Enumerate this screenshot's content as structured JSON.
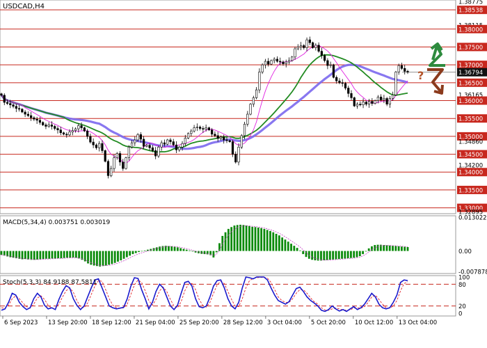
{
  "chart_data": [
    {
      "type": "candlestick",
      "title": "USDCAD,H4",
      "price_labels": [
        "1.38775",
        "1.38538",
        "1.38115",
        "1.38000",
        "1.37500",
        "1.37000",
        "1.36794",
        "1.36500",
        "1.36165",
        "1.36000",
        "1.35500",
        "1.35000",
        "1.34860",
        "1.34500",
        "1.34200",
        "1.34000",
        "1.33500",
        "1.33000",
        "1.32895"
      ],
      "levels": [
        1.38538,
        1.38,
        1.375,
        1.37,
        1.365,
        1.36,
        1.355,
        1.35,
        1.345,
        1.34,
        1.335,
        1.33
      ],
      "current_price": 1.36794,
      "ylim": [
        1.32895,
        1.38775
      ],
      "x_labels": [
        "6 Sep 2023",
        "13 Sep 20:00",
        "18 Sep 12:00",
        "21 Sep 04:00",
        "25 Sep 20:00",
        "28 Sep 12:00",
        "3 Oct 04:00",
        "5 Oct 20:00",
        "10 Oct 12:00",
        "13 Oct 04:00"
      ],
      "close": [
        1.3615,
        1.3595,
        1.3592,
        1.3588,
        1.3584,
        1.3578,
        1.3576,
        1.3568,
        1.3562,
        1.3558,
        1.3552,
        1.3548,
        1.3545,
        1.3539,
        1.3532,
        1.3528,
        1.3532,
        1.3528,
        1.3522,
        1.3518,
        1.351,
        1.3506,
        1.3504,
        1.3512,
        1.3516,
        1.3521,
        1.353,
        1.3524,
        1.3515,
        1.35,
        1.3484,
        1.3476,
        1.3468,
        1.348,
        1.346,
        1.343,
        1.339,
        1.341,
        1.344,
        1.3452,
        1.3428,
        1.341,
        1.344,
        1.347,
        1.3482,
        1.349,
        1.3505,
        1.3492,
        1.3472,
        1.3475,
        1.3468,
        1.346,
        1.3445,
        1.347,
        1.3482,
        1.3478,
        1.349,
        1.3485,
        1.3476,
        1.3462,
        1.347,
        1.348,
        1.3495,
        1.3508,
        1.3515,
        1.3524,
        1.3526,
        1.3522,
        1.352,
        1.3524,
        1.3518,
        1.3506,
        1.3502,
        1.3494,
        1.3498,
        1.349,
        1.3488,
        1.3485,
        1.345,
        1.3428,
        1.347,
        1.3502,
        1.3534,
        1.3562,
        1.359,
        1.3608,
        1.363,
        1.368,
        1.37,
        1.371,
        1.3702,
        1.3712,
        1.3716,
        1.371,
        1.3708,
        1.3703,
        1.3708,
        1.3712,
        1.3722,
        1.3745,
        1.375,
        1.3754,
        1.3748,
        1.377,
        1.3762,
        1.3748,
        1.3755,
        1.3738,
        1.3726,
        1.3712,
        1.3698,
        1.37,
        1.3665,
        1.3655,
        1.365,
        1.3648,
        1.3635,
        1.362,
        1.3608,
        1.3585,
        1.359,
        1.3588,
        1.3596,
        1.359,
        1.3598,
        1.3592,
        1.36,
        1.361,
        1.3602,
        1.3606,
        1.359,
        1.3606,
        1.3616,
        1.368,
        1.3698,
        1.369,
        1.3682,
        1.368
      ],
      "macd": {
        "label": "MACD(5,34,4)",
        "values_text": "0.003751 0.003019",
        "ticks": [
          "0.013022",
          "0.00",
          "-0.007878"
        ],
        "ylim": [
          -0.007878,
          0.013022
        ],
        "histogram": [
          -0.0015,
          -0.0018,
          -0.0021,
          -0.0024,
          -0.0026,
          -0.0028,
          -0.003,
          -0.0032,
          -0.0031,
          -0.0033,
          -0.0034,
          -0.0034,
          -0.0033,
          -0.0032,
          -0.0031,
          -0.003,
          -0.003,
          -0.0029,
          -0.0029,
          -0.0028,
          -0.0028,
          -0.0027,
          -0.0026,
          -0.0026,
          -0.0025,
          -0.0026,
          -0.0029,
          -0.0034,
          -0.004,
          -0.0048,
          -0.0053,
          -0.0056,
          -0.0058,
          -0.006,
          -0.0058,
          -0.0056,
          -0.0053,
          -0.005,
          -0.0046,
          -0.0041,
          -0.0036,
          -0.003,
          -0.0024,
          -0.0018,
          -0.0012,
          -0.0008,
          -0.0004,
          -0.0001,
          0.0002,
          0.0005,
          0.0008,
          0.0011,
          0.0014,
          0.0017,
          0.0019,
          0.002,
          0.0019,
          0.0018,
          0.0016,
          0.0014,
          0.0011,
          0.0008,
          0.0005,
          0.0002,
          -0.0002,
          -0.0006,
          -0.0009,
          -0.0011,
          -0.0012,
          -0.0013,
          -0.0016,
          -0.0025,
          -0.0005,
          0.003,
          0.0058,
          0.0072,
          0.0085,
          0.0092,
          0.0098,
          0.01,
          0.0101,
          0.01,
          0.0098,
          0.0096,
          0.0093,
          0.0092,
          0.009,
          0.0088,
          0.0085,
          0.0081,
          0.0077,
          0.0072,
          0.0066,
          0.006,
          0.0052,
          0.0044,
          0.0036,
          0.0028,
          0.002,
          0.0012,
          0.0002,
          -0.0012,
          -0.0023,
          -0.003,
          -0.0034,
          -0.0036,
          -0.0037,
          -0.0037,
          -0.0036,
          -0.0035,
          -0.0034,
          -0.0033,
          -0.0032,
          -0.0031,
          -0.003,
          -0.0029,
          -0.0028,
          -0.0027,
          -0.0026,
          -0.0024,
          -0.002,
          -0.0012,
          -0.0002,
          0.001,
          0.0018,
          0.0023,
          0.0024,
          0.0024,
          0.0023,
          0.0022,
          0.0021,
          0.002,
          0.0019,
          0.0018,
          0.0017,
          0.0016,
          0.0015
        ]
      },
      "stoch": {
        "label": "Stoch(5,3,3) 84.9188 87.5811",
        "ticks": [
          "100",
          "80",
          "20",
          "0"
        ],
        "levels": [
          80,
          20
        ],
        "ylim": [
          0,
          100
        ],
        "k": [
          8,
          12,
          30,
          55,
          50,
          30,
          18,
          10,
          15,
          40,
          55,
          45,
          22,
          12,
          15,
          10,
          38,
          60,
          76,
          70,
          40,
          22,
          10,
          20,
          45,
          70,
          92,
          95,
          70,
          45,
          20,
          15,
          12,
          14,
          16,
          40,
          75,
          98,
          96,
          65,
          40,
          12,
          30,
          60,
          80,
          70,
          45,
          20,
          10,
          22,
          55,
          85,
          88,
          75,
          40,
          18,
          15,
          20,
          45,
          75,
          90,
          92,
          70,
          40,
          20,
          12,
          30,
          70,
          100,
          98,
          95,
          100,
          100,
          100,
          92,
          70,
          50,
          35,
          30,
          25,
          32,
          50,
          68,
          72,
          60,
          45,
          35,
          28,
          20,
          8,
          5,
          10,
          20,
          12,
          6,
          10,
          5,
          12,
          18,
          10,
          15,
          25,
          40,
          55,
          45,
          25,
          15,
          12,
          15,
          30,
          50,
          85,
          92,
          90
        ],
        "d": [
          15,
          14,
          22,
          40,
          48,
          40,
          28,
          18,
          14,
          25,
          42,
          48,
          38,
          22,
          14,
          12,
          25,
          45,
          62,
          70,
          58,
          35,
          18,
          15,
          28,
          52,
          75,
          90,
          88,
          65,
          40,
          22,
          15,
          13,
          15,
          25,
          52,
          78,
          92,
          85,
          62,
          35,
          22,
          38,
          62,
          72,
          60,
          38,
          20,
          15,
          32,
          62,
          80,
          82,
          65,
          38,
          22,
          17,
          30,
          55,
          78,
          88,
          82,
          60,
          38,
          20,
          18,
          40,
          70,
          90,
          96,
          98,
          99,
          99,
          97,
          85,
          65,
          45,
          35,
          30,
          30,
          40,
          55,
          65,
          65,
          55,
          42,
          32,
          25,
          15,
          9,
          8,
          12,
          14,
          12,
          9,
          8,
          9,
          14,
          15,
          14,
          18,
          30,
          45,
          50,
          38,
          25,
          15,
          14,
          20,
          35,
          62,
          82,
          87
        ]
      }
    }
  ]
}
